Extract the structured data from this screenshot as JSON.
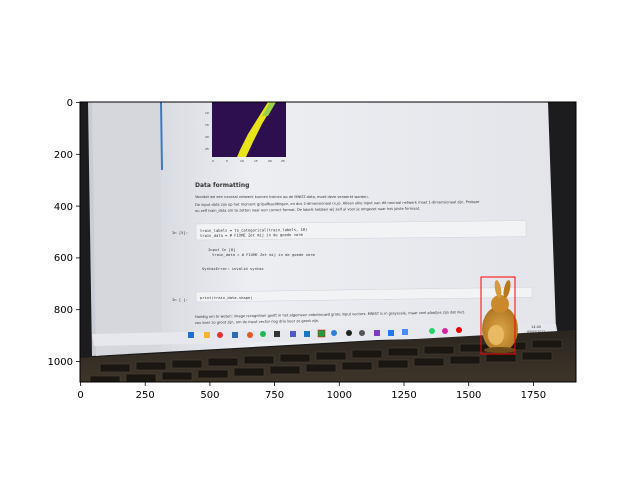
{
  "axes": {
    "x_ticks": [
      "0",
      "250",
      "500",
      "750",
      "1000",
      "1250",
      "1500",
      "1750"
    ],
    "y_ticks": [
      "0",
      "200",
      "400",
      "600",
      "800",
      "1000"
    ]
  },
  "notebook": {
    "heading": "Data formatting",
    "para1": "Voordat we een neuraal netwerk kunnen trainen op de MNIST-data, moet deze verwerkt worden.",
    "para2a": "De input data zijn op het moment grijsafbeeldingen, en dus 2-dimensionaal (x,y). Alleen elke input van dit neuraal netwerk moet 1-dimensionaal zijn. Probeer",
    "para2b": "nu zelf train_data om te zetten naar een correct format. De labels hebben wij zelf al voor je omgezet naar het juiste formaat.",
    "cell1_prompt": "In [5]:",
    "cell1_line1": "train_labels = to_categorical(train_labels, 10)",
    "cell1_line2": "train_data = # FIXME Zet mij in de goede vorm",
    "err_line1": "Input In [8]",
    "err_line2": "train_data = # FIXME Zet mij in de goede vorm",
    "err_line3": "SyntaxError: invalid syntax",
    "cell2_prompt": "In [ ]:",
    "cell2_code": "print(train_data.shape)",
    "para3a": "Handig om te weten: image recognition geeft in het algemeen onbetrouwd grote input vectors. MNIST is in grayscale, maar veel plaatjes zijn dat niet.",
    "para3b": "zou keer zo groot zijn, om de input vector nog drie keer zo groot zijn.",
    "taskbar_time": "14:40",
    "taskbar_date": "05/05/2022"
  },
  "mini_plot_ticks": {
    "y": [
      "10",
      "15",
      "20",
      "25"
    ],
    "x": [
      "0",
      "5",
      "10",
      "15",
      "20",
      "25"
    ]
  },
  "colors": {
    "bbox": "#ff0000",
    "heatmap_bg": "#2d0e4e",
    "heatmap_fg": "#e8e418"
  }
}
